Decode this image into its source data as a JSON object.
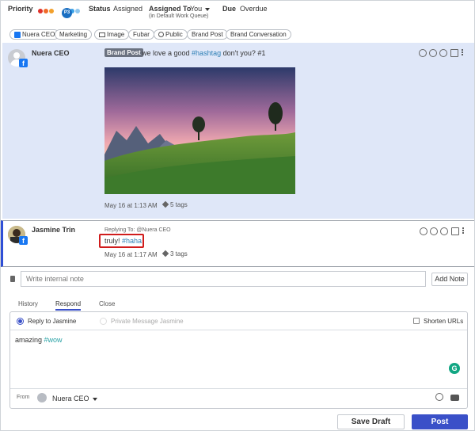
{
  "header": {
    "priority_label": "Priority",
    "priority_badge": "P3",
    "status_label": "Status",
    "status_value": "Assigned",
    "assigned_label": "Assigned To",
    "assigned_value": "You",
    "assigned_sub": "(in Default Work Queue)",
    "due_label": "Due",
    "due_value": "Overdue"
  },
  "tags": [
    "Nuera CEO",
    "Marketing",
    "Image",
    "Fubar",
    "Public",
    "Brand Post",
    "Brand Conversation"
  ],
  "post": {
    "author": "Nuera CEO",
    "badge": "Brand Post",
    "text_before": "we love a good ",
    "hashtag": "#hashtag",
    "text_after": " don't you? #1",
    "time": "May 16 at 1:13 AM",
    "tag_count": "5 tags"
  },
  "reply": {
    "author": "Jasmine Trin",
    "replying_to": "Replying To: @Nuera CEO",
    "text": "truly! ",
    "hashtag": "#haha",
    "time": "May 16 at 1:17 AM",
    "tag_count": "3 tags"
  },
  "note": {
    "placeholder": "Write internal note",
    "button": "Add Note"
  },
  "tabs": [
    "History",
    "Respond",
    "Close"
  ],
  "compose": {
    "reply_option": "Reply to Jasmine",
    "pm_option": "Private Message Jasmine",
    "shorten_urls": "Shorten URLs",
    "text": "amazing ",
    "hashtag": "#wow",
    "from_label": "From",
    "from_account": "Nuera CEO"
  },
  "buttons": {
    "save_draft": "Save Draft",
    "post": "Post"
  },
  "colors": {
    "accent": "#3a50c8",
    "post_bg": "#dfe7f8",
    "highlight": "#d01c1c",
    "priority_dots": [
      "#e0312b",
      "#f06a2a",
      "#f2a02b",
      "#3aa2e8",
      "#8dc6ee"
    ]
  }
}
